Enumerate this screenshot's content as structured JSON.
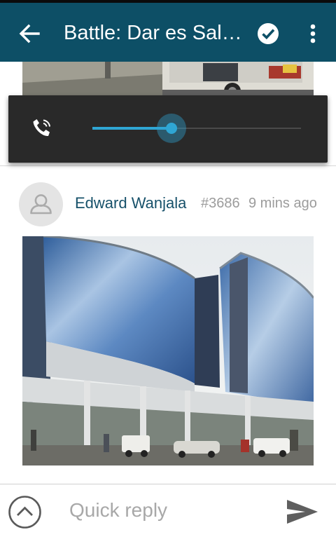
{
  "app_bar": {
    "title": "Battle: Dar es Salaam vs Nairobi",
    "back_icon": "arrow-left-icon",
    "check_icon": "check-circle-icon",
    "overflow_icon": "more-vert-icon",
    "background": "#0d4f66"
  },
  "volume_panel": {
    "icon": "in-call-phone-volume-icon",
    "level": 0.38,
    "accent": "#2fa6d4"
  },
  "post": {
    "author": "Edward Wanjala",
    "post_number": "#3686",
    "time": "9 mins ago",
    "avatar_icon": "person-avatar-icon",
    "image": "photo-of-glass-office-building"
  },
  "previous_post": {
    "image": "photo-of-parked-cars"
  },
  "bottom_bar": {
    "expand_icon": "chevron-up-circle-icon",
    "reply_placeholder": "Quick reply",
    "send_icon": "send-icon"
  }
}
